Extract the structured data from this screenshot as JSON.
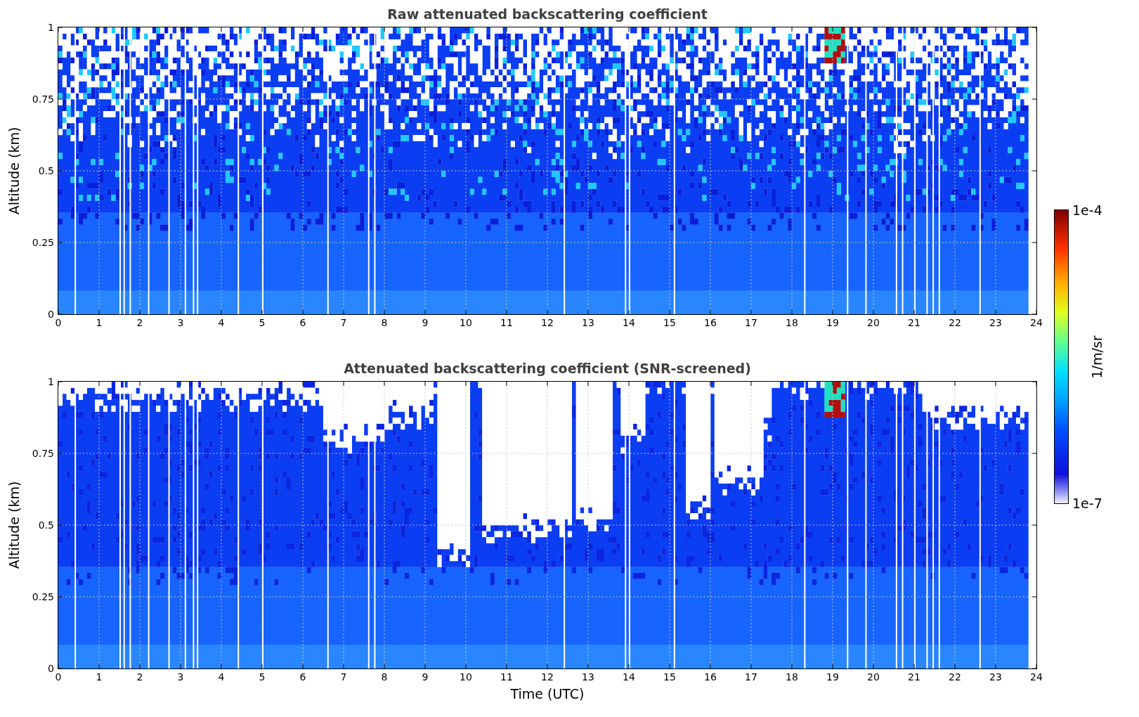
{
  "panels": [
    {
      "kind": "raw",
      "title": "Raw attenuated backscattering coefficient",
      "ylabel": "Altitude (km)",
      "yticks": [
        "1",
        "0.75",
        "0.5",
        "0.25",
        "0"
      ],
      "xticks": [
        "0",
        "1",
        "2",
        "3",
        "4",
        "5",
        "6",
        "7",
        "8",
        "9",
        "10",
        "11",
        "12",
        "13",
        "14",
        "15",
        "16",
        "17",
        "18",
        "19",
        "20",
        "21",
        "22",
        "23",
        "24"
      ]
    },
    {
      "kind": "screened",
      "title": "Attenuated backscattering coefficient (SNR-screened)",
      "ylabel": "Altitude (km)",
      "yticks": [
        "1",
        "0.75",
        "0.5",
        "0.25",
        "0"
      ],
      "xticks": [
        "0",
        "1",
        "2",
        "3",
        "4",
        "5",
        "6",
        "7",
        "8",
        "9",
        "10",
        "11",
        "12",
        "13",
        "14",
        "15",
        "16",
        "17",
        "18",
        "19",
        "20",
        "21",
        "22",
        "23",
        "24"
      ],
      "xlabel": "Time (UTC)"
    }
  ],
  "colorbar": {
    "label": "1/m/sr",
    "max_label": "1e-4",
    "min_label": "1e-7"
  }
}
